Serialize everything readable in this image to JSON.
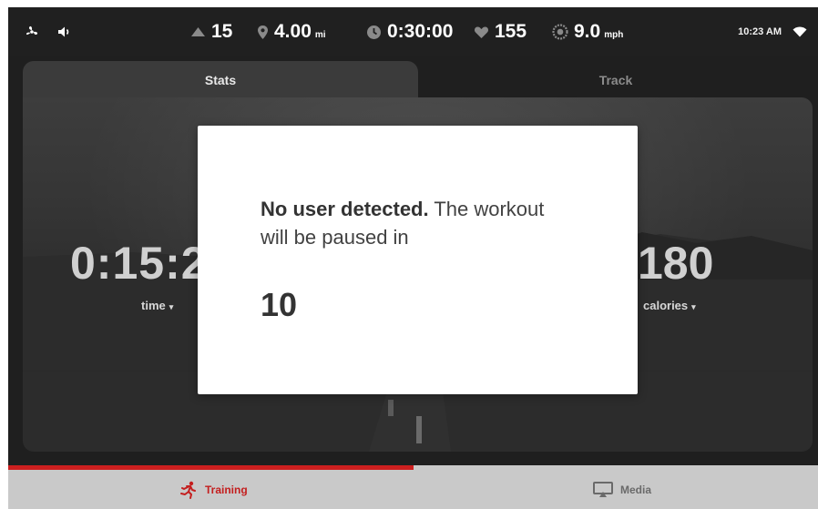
{
  "status_bar": {
    "incline": "15",
    "distance": "4.00",
    "distance_unit": "mi",
    "time": "0:30:00",
    "heart_rate": "155",
    "speed": "9.0",
    "speed_unit": "mph",
    "clock": "10:23 AM"
  },
  "tabs": [
    {
      "label": "Stats",
      "active": true
    },
    {
      "label": "Track",
      "active": false
    }
  ],
  "stats": {
    "left_value": "0:15:2",
    "left_label": "time",
    "right_value": "180",
    "right_label": "calories",
    "caret": "▾"
  },
  "dialog": {
    "title_bold": "No user detected.",
    "message": "The workout will be paused in",
    "countdown": "10"
  },
  "bottom_nav": {
    "training_label": "Training",
    "media_label": "Media",
    "progress": 0.5
  },
  "colors": {
    "accent": "#cc1f1f",
    "bar_bg": "#202020",
    "nav_bg": "#c9c9c9"
  },
  "icons": [
    "fan-icon",
    "volume-icon",
    "incline-icon",
    "location-pin-icon",
    "clock-icon",
    "heart-icon",
    "speed-dial-icon",
    "wifi-icon",
    "runner-icon",
    "media-screen-icon"
  ]
}
